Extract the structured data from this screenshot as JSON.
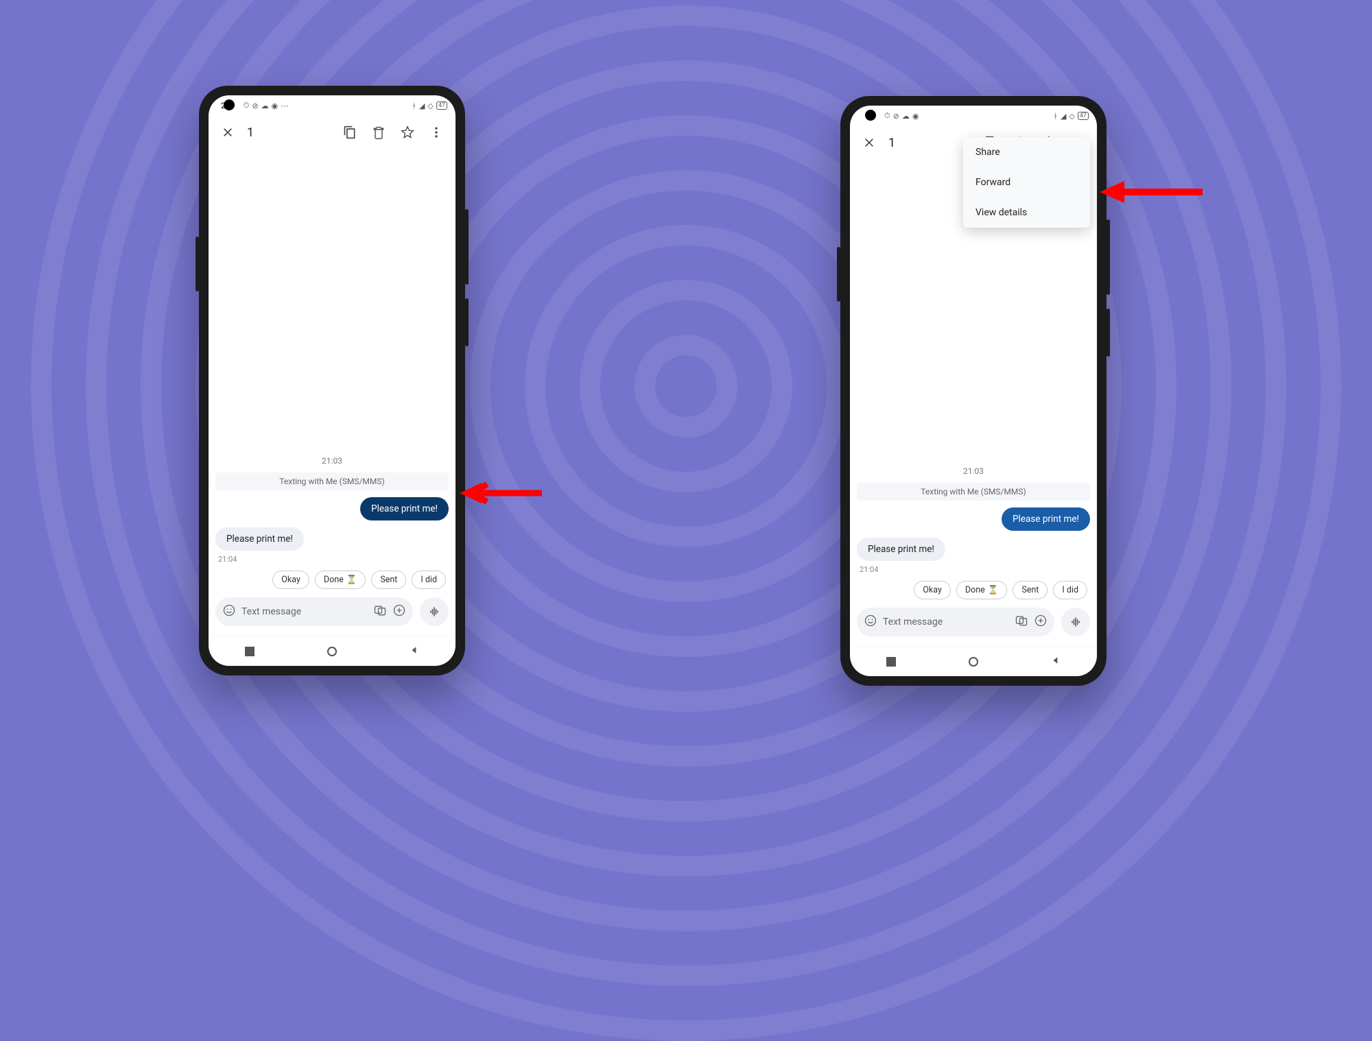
{
  "status": {
    "time_prefix": "2",
    "battery": "47"
  },
  "appbar": {
    "selected_count": "1"
  },
  "conversation": {
    "timestamp": "21:03",
    "info_text": "Texting with Me (SMS/MMS)",
    "sent_msg": "Please print me!",
    "recv_msg": "Please print me!",
    "recv_time": "21:04"
  },
  "chips": {
    "c1": "Okay",
    "c2": "Done",
    "c2_emoji": "⏳",
    "c3": "Sent",
    "c4": "I did"
  },
  "input": {
    "placeholder": "Text message"
  },
  "menu": {
    "share": "Share",
    "forward": "Forward",
    "details": "View details"
  }
}
